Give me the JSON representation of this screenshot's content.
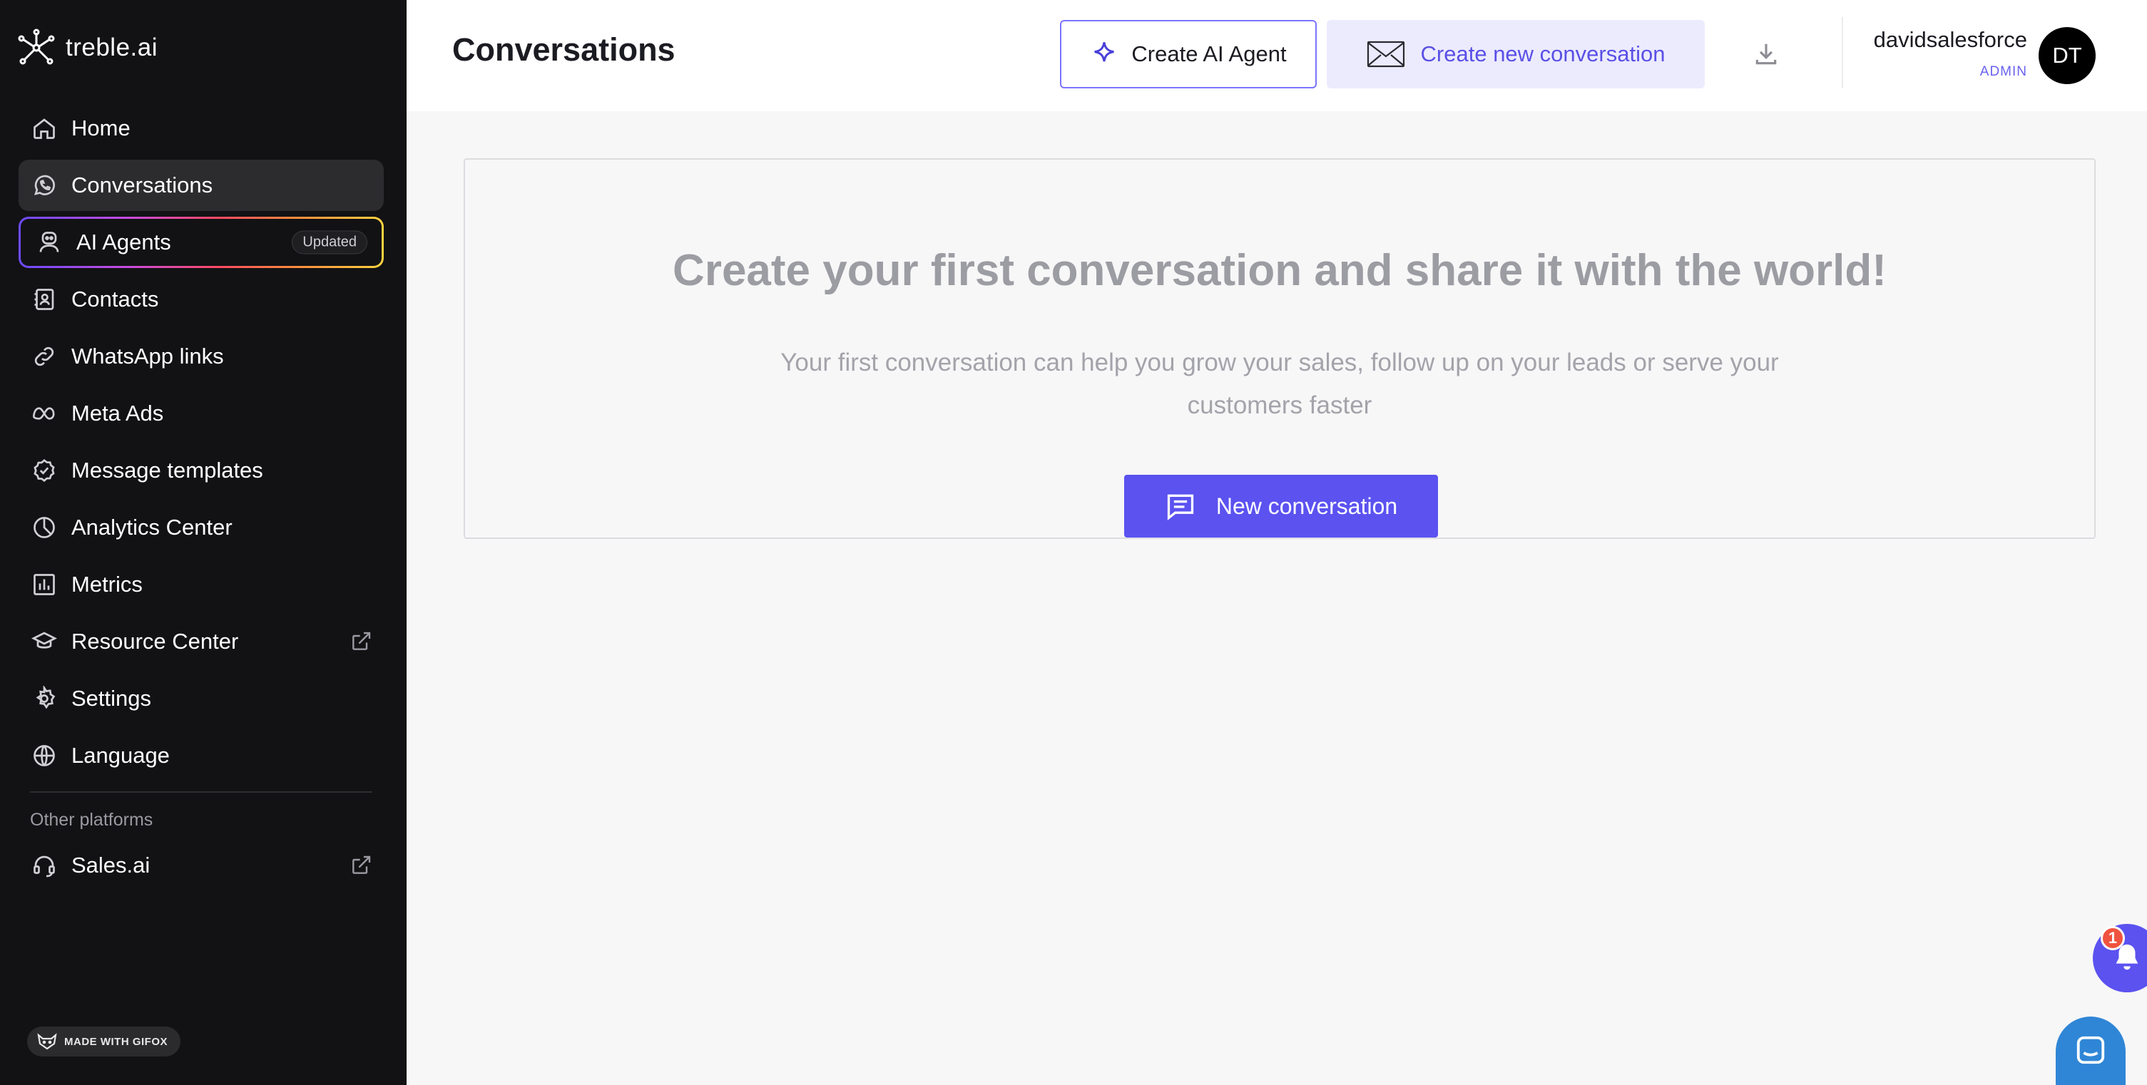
{
  "brand": {
    "name": "treble.ai"
  },
  "sidebar": {
    "items": [
      {
        "label": "Home",
        "icon": "home-icon"
      },
      {
        "label": "Conversations",
        "icon": "whatsapp-icon"
      },
      {
        "label": "AI Agents",
        "icon": "robot-icon",
        "badge": "Updated"
      },
      {
        "label": "Contacts",
        "icon": "contacts-book-icon"
      },
      {
        "label": "WhatsApp links",
        "icon": "link-icon"
      },
      {
        "label": "Meta Ads",
        "icon": "meta-icon"
      },
      {
        "label": "Message templates",
        "icon": "badge-check-icon"
      },
      {
        "label": "Analytics Center",
        "icon": "pie-chart-icon"
      },
      {
        "label": "Metrics",
        "icon": "bar-chart-icon"
      },
      {
        "label": "Resource Center",
        "icon": "graduation-cap-icon"
      },
      {
        "label": "Settings",
        "icon": "gear-icon"
      },
      {
        "label": "Language",
        "icon": "globe-icon"
      }
    ],
    "section_label": "Other platforms",
    "other_items": [
      {
        "label": "Sales.ai",
        "icon": "headset-icon"
      }
    ],
    "gifox_label": "MADE WITH GIFOX"
  },
  "header": {
    "title": "Conversations",
    "create_agent_label": "Create AI Agent",
    "create_conversation_label": "Create new conversation",
    "user": {
      "name": "davidsalesforce",
      "role": "ADMIN",
      "initials": "DT"
    }
  },
  "empty_state": {
    "heading": "Create your first conversation and share it with the world!",
    "subtext": "Your first conversation can help you grow your sales, follow up on your leads or serve your customers faster",
    "button_label": "New conversation"
  },
  "notifications": {
    "count": "1"
  },
  "colors": {
    "sidebar_bg": "#121214",
    "accent": "#5b52f0",
    "accent_light": "#ecebfe",
    "badge_red": "#f0533f",
    "chat_blue": "#2f86d6"
  }
}
